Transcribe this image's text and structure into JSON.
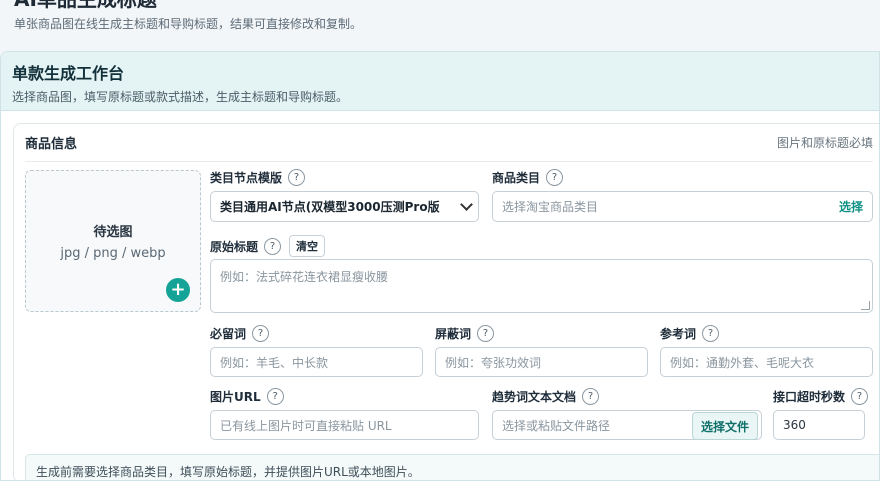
{
  "page": {
    "title": "AI单品生成标题",
    "subtitle": "单张商品图在线生成主标题和导购标题，结果可直接修改和复制。"
  },
  "workbench": {
    "title": "单款生成工作台",
    "subtitle": "选择商品图，填写原标题或款式描述，生成主标题和导购标题。"
  },
  "card": {
    "title": "商品信息",
    "hint": "图片和原标题必填"
  },
  "image_drop": {
    "label": "待选图",
    "formats": "jpg / png / webp",
    "add_icon": "+"
  },
  "help_glyph": "?",
  "fields": {
    "template": {
      "label": "类目节点模版",
      "value": "类目通用AI节点(双模型3000压测Pro版"
    },
    "category": {
      "label": "商品类目",
      "placeholder": "选择淘宝商品类目",
      "action": "选择"
    },
    "original_title": {
      "label": "原始标题",
      "clear": "清空",
      "placeholder": "例如：法式碎花连衣裙显瘦收腰"
    },
    "must_keep": {
      "label": "必留词",
      "placeholder": "例如：羊毛、中长款"
    },
    "blocked": {
      "label": "屏蔽词",
      "placeholder": "例如：夸张功效词"
    },
    "reference": {
      "label": "参考词",
      "placeholder": "例如：通勤外套、毛呢大衣"
    },
    "image_url": {
      "label": "图片URL",
      "placeholder": "已有线上图片时可直接粘贴 URL"
    },
    "trend_doc": {
      "label": "趋势词文本文档",
      "placeholder": "选择或粘贴文件路径",
      "action": "选择文件"
    },
    "timeout": {
      "label": "接口超时秒数",
      "value": "360"
    }
  },
  "bottom_note": "生成前需要选择商品类目，填写原始标题，并提供图片URL或本地图片。"
}
